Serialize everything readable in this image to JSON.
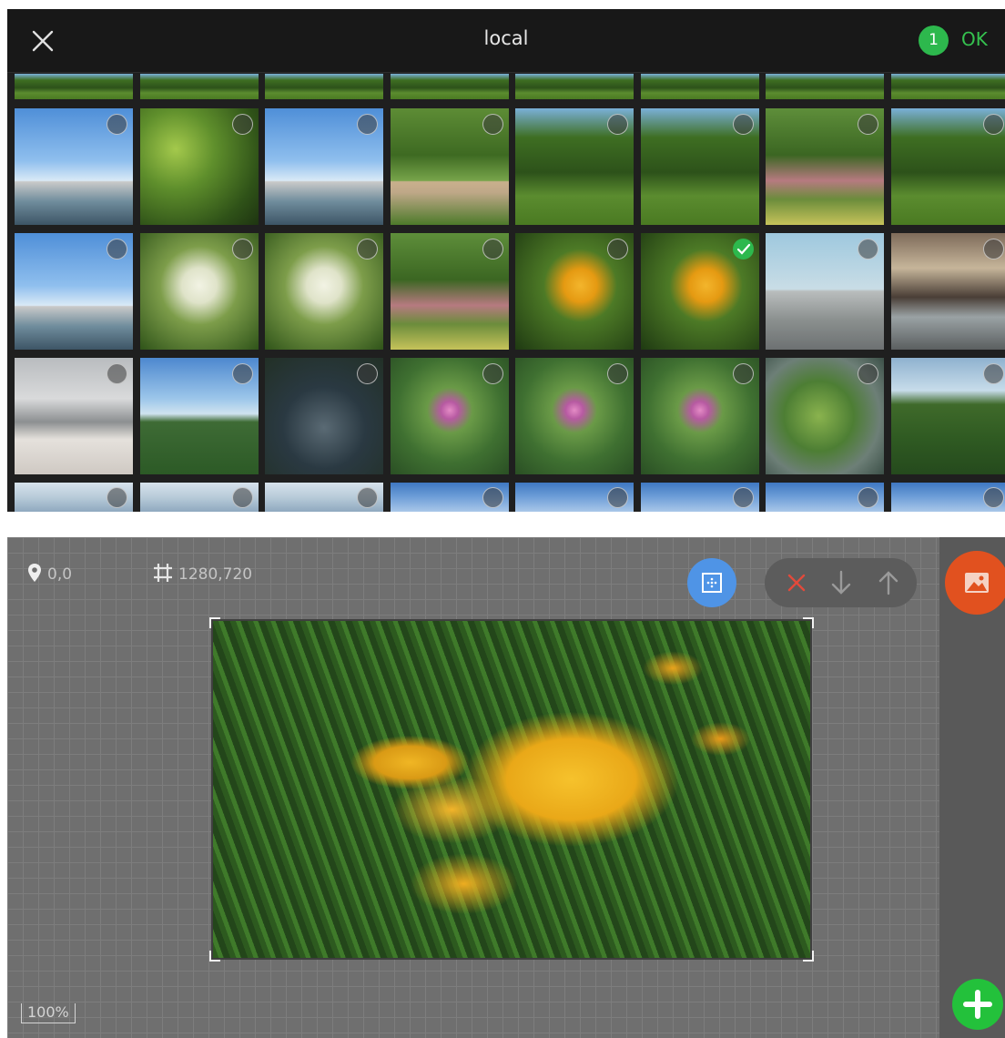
{
  "picker": {
    "title": "local",
    "selected_count": "1",
    "ok_label": "OK",
    "accent": "#2db84d",
    "photos": [
      {
        "style": "sky",
        "checked": false
      },
      {
        "style": "green",
        "checked": false
      },
      {
        "style": "sky",
        "checked": false
      },
      {
        "style": "park",
        "checked": false
      },
      {
        "style": "trees",
        "checked": false
      },
      {
        "style": "trees",
        "checked": false
      },
      {
        "style": "garden",
        "checked": false
      },
      {
        "style": "trees",
        "checked": false
      },
      {
        "style": "sky",
        "checked": false
      },
      {
        "style": "flowerwhite",
        "checked": false
      },
      {
        "style": "flowerwhite",
        "checked": false
      },
      {
        "style": "garden",
        "checked": false
      },
      {
        "style": "yellowflower",
        "checked": false
      },
      {
        "style": "yellowflower",
        "checked": true
      },
      {
        "style": "airport",
        "checked": false
      },
      {
        "style": "terminal",
        "checked": false
      },
      {
        "style": "hall",
        "checked": false
      },
      {
        "style": "lotus",
        "checked": false
      },
      {
        "style": "pond",
        "checked": false
      },
      {
        "style": "lily",
        "checked": false
      },
      {
        "style": "lily",
        "checked": false
      },
      {
        "style": "lily",
        "checked": false
      },
      {
        "style": "lilypads",
        "checked": false
      },
      {
        "style": "field",
        "checked": false
      },
      {
        "style": "cloud",
        "checked": false
      },
      {
        "style": "cloud",
        "checked": false
      },
      {
        "style": "cloud",
        "checked": false
      },
      {
        "style": "bluesky",
        "checked": false
      },
      {
        "style": "bluesky",
        "checked": false
      },
      {
        "style": "bluesky",
        "checked": false
      },
      {
        "style": "bluesky",
        "checked": false
      },
      {
        "style": "bluesky",
        "checked": false
      }
    ]
  },
  "editor": {
    "position": "0,0",
    "size": "1280,720",
    "zoom": "100%",
    "icons": [
      "location-pin-icon",
      "crop-icon",
      "frame-icon",
      "delete-icon",
      "move-down-icon",
      "move-up-icon",
      "image-icon",
      "add-icon"
    ],
    "colors": {
      "frame_button": "#4f94e6",
      "image_button": "#e1511f",
      "add_button": "#23c13b"
    }
  }
}
